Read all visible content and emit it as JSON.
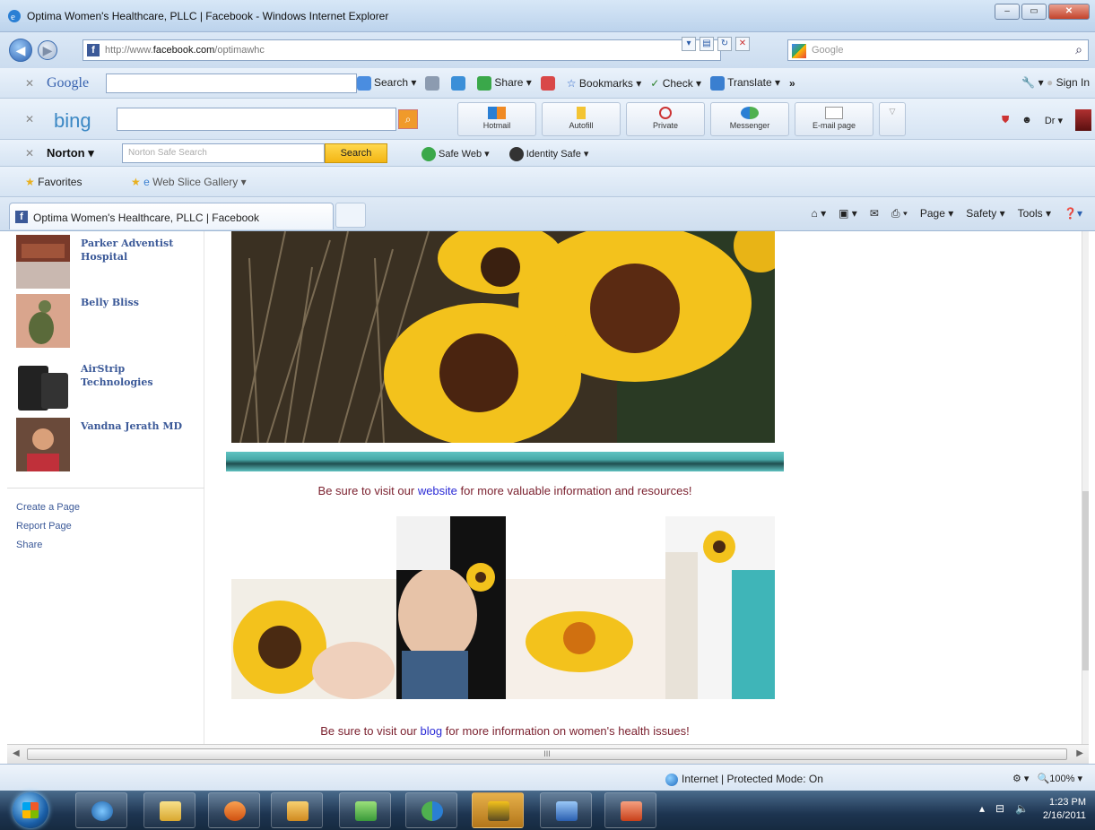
{
  "window": {
    "title": "Optima Women's Healthcare, PLLC | Facebook - Windows Internet Explorer"
  },
  "address": {
    "url_prefix": "http://www.",
    "url_domain": "facebook.com",
    "url_path": "/optimawhc",
    "search_placeholder": "Google"
  },
  "google_toolbar": {
    "logo": "Google",
    "items": [
      "Search",
      "Share",
      "Bookmarks",
      "Check",
      "Translate",
      "»"
    ],
    "signin": "Sign In"
  },
  "bing_toolbar": {
    "logo": "bing",
    "buttons": [
      "Hotmail",
      "Autofill",
      "Private",
      "Messenger",
      "E-mail page"
    ],
    "user": "Dr"
  },
  "norton_toolbar": {
    "logo": "Norton",
    "search_placeholder": "Norton Safe Search",
    "search_button": "Search",
    "items": [
      "Safe Web",
      "Identity Safe"
    ]
  },
  "favorites_bar": {
    "favorites": "Favorites",
    "web_slice": "Web Slice Gallery"
  },
  "tab": {
    "label": "Optima Women's Healthcare, PLLC | Facebook"
  },
  "command_bar": [
    "Page",
    "Safety",
    "Tools"
  ],
  "sidebar": {
    "liked_pages": [
      {
        "name": "Parker Adventist Hospital"
      },
      {
        "name": "Belly Bliss"
      },
      {
        "name": "AirStrip Technologies"
      },
      {
        "name": "Vandna Jerath MD"
      }
    ],
    "links": [
      "Create a Page",
      "Report Page",
      "Share"
    ]
  },
  "main": {
    "visit_website": {
      "before": "Be sure to visit our ",
      "link": "website",
      "after": " for more valuable information and resources!"
    },
    "visit_blog": {
      "before": "Be sure to visit our ",
      "link": "blog",
      "after": " for more information on women's health issues!"
    }
  },
  "status": {
    "zone": "Internet | Protected Mode: On",
    "zoom": "100%"
  },
  "taskbar": {
    "time": "1:23 PM",
    "date": "2/16/2011"
  }
}
